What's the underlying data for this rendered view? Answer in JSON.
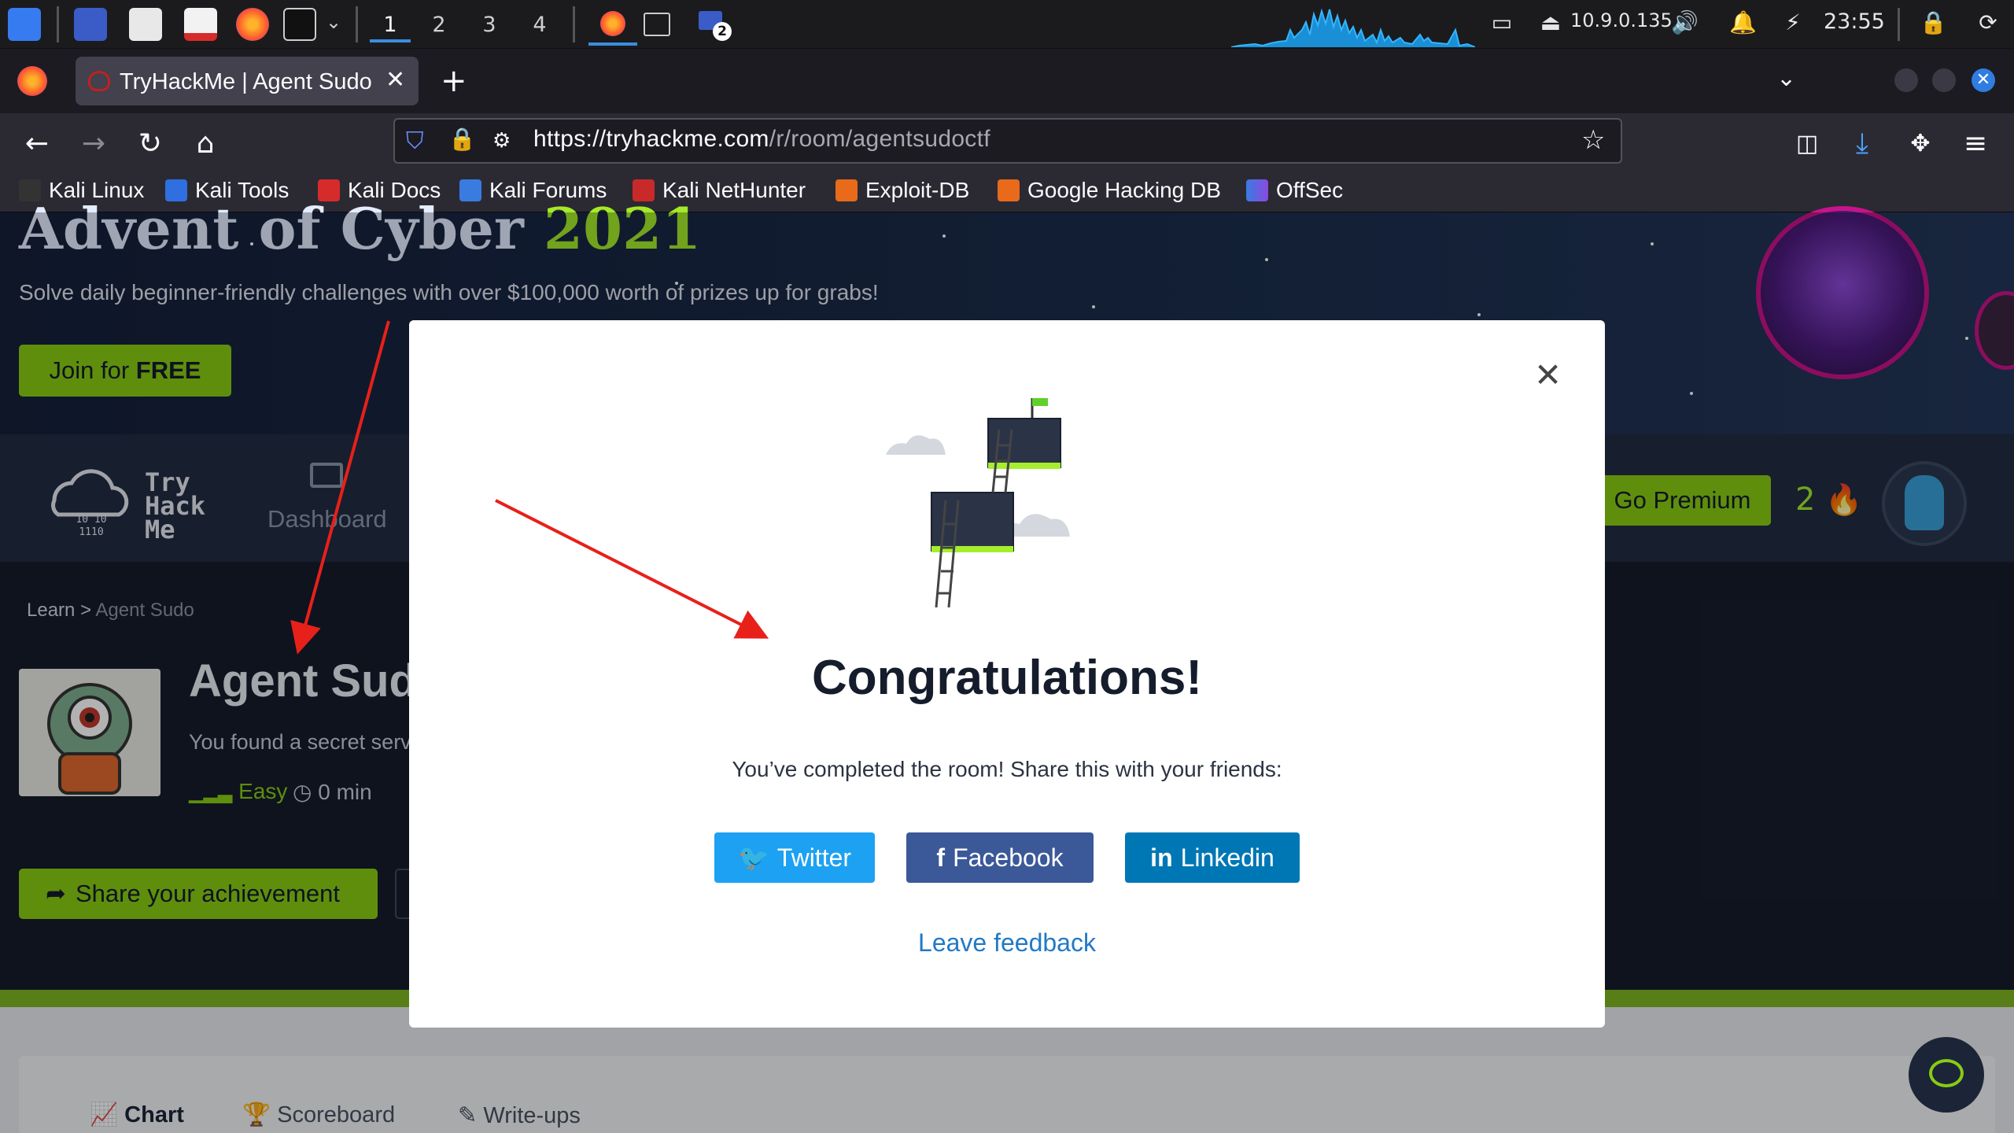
{
  "taskbar": {
    "workspaces": [
      "1",
      "2",
      "3",
      "4"
    ],
    "active_workspace": "1",
    "ip": "10.9.0.135",
    "clock": "23:55",
    "window_badge": "2"
  },
  "browser": {
    "tab_title": "TryHackMe | Agent Sudo",
    "url_domain": "https://tryhackme.com",
    "url_path": "/r/room/agentsudoctf",
    "bookmarks": [
      "Kali Linux",
      "Kali Tools",
      "Kali Docs",
      "Kali Forums",
      "Kali NetHunter",
      "Exploit-DB",
      "Google Hacking DB",
      "OffSec"
    ]
  },
  "banner": {
    "title_main": "Advent of Cyber",
    "title_year": "2021",
    "subtitle": "Solve daily beginner-friendly challenges with over $100,000 worth of prizes up for grabs!",
    "join_label": "Join for",
    "join_bold": "FREE"
  },
  "site_nav": {
    "logo_try": "Try",
    "logo_hack": "Hack",
    "logo_me": "Me",
    "dashboard": "Dashboard",
    "premium": "Go Premium",
    "streak": "2"
  },
  "room": {
    "breadcrumb_root": "Learn",
    "breadcrumb_sep": ">",
    "breadcrumb_current": "Agent Sudo",
    "title": "Agent Sudo",
    "description": "You found a secret server located under the deep sea.",
    "difficulty": "Easy",
    "time": "0 min",
    "share_label": "Share your achievement"
  },
  "room_tabs": [
    "Chart",
    "Scoreboard",
    "Write-ups"
  ],
  "modal": {
    "title": "Congratulations!",
    "subtitle": "You’ve completed the room! Share this with your friends:",
    "twitter": "Twitter",
    "facebook": "Facebook",
    "linkedin": "Linkedin",
    "linkedin_glyph": "in",
    "facebook_glyph": "f",
    "feedback": "Leave feedback"
  },
  "colors": {
    "thm_green": "#88cc14",
    "twitter": "#1da1f2",
    "facebook": "#3b5998",
    "linkedin": "#0077b5",
    "link_blue": "#2279c4",
    "annotation_red": "#e8201a"
  }
}
